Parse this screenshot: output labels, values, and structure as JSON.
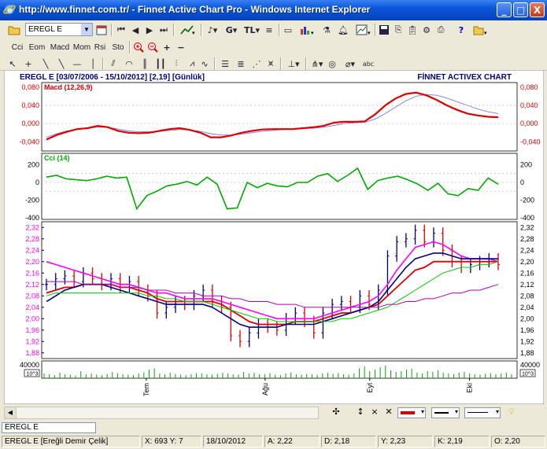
{
  "window": {
    "title": "http://www.finnet.com.tr/ - Finnet Active Chart Pro - Windows Internet Explorer",
    "minimize": "_",
    "maximize": "□",
    "close": "X"
  },
  "toolbar1": {
    "symbol": "EREGL E",
    "g_label": "G",
    "tl_label": "TL"
  },
  "toolbar2": {
    "indicators": [
      "Cci",
      "Eom",
      "Macd",
      "Mom",
      "Rsi",
      "Sto"
    ]
  },
  "chart_header": {
    "info": "EREGL E  [03/07/2006 - 15/10/2012]  [2,19]  [Günlük]",
    "brand": "FİNNET ACTIVEX CHART"
  },
  "chart_data": [
    {
      "type": "line",
      "title": "Macd (12,26,9)",
      "ylim": [
        -0.06,
        0.09
      ],
      "yticks": [
        "0,080",
        "0,040",
        "0,000",
        "-0,040"
      ],
      "yvalues": [
        0.08,
        0.04,
        0.0,
        -0.04
      ],
      "series": [
        {
          "color": "#dd0000",
          "values": [
            -0.035,
            -0.025,
            -0.018,
            -0.012,
            -0.01,
            -0.005,
            -0.008,
            -0.016,
            -0.02,
            -0.021,
            -0.02,
            -0.016,
            -0.012,
            -0.01,
            -0.014,
            -0.02,
            -0.03,
            -0.03,
            -0.026,
            -0.02,
            -0.016,
            -0.013,
            -0.012,
            -0.012,
            -0.012,
            -0.01,
            -0.008,
            -0.005,
            0.002,
            0.004,
            0.004,
            0.005,
            0.02,
            0.04,
            0.055,
            0.065,
            0.068,
            0.062,
            0.052,
            0.04,
            0.03,
            0.022,
            0.018,
            0.015,
            0.014
          ]
        },
        {
          "color": "#7a7af0",
          "values": [
            -0.03,
            -0.022,
            -0.016,
            -0.012,
            -0.01,
            -0.008,
            -0.008,
            -0.012,
            -0.016,
            -0.018,
            -0.018,
            -0.017,
            -0.015,
            -0.013,
            -0.014,
            -0.017,
            -0.022,
            -0.025,
            -0.025,
            -0.023,
            -0.02,
            -0.017,
            -0.015,
            -0.013,
            -0.012,
            -0.011,
            -0.01,
            -0.008,
            -0.004,
            0.0,
            0.002,
            0.003,
            0.01,
            0.022,
            0.036,
            0.05,
            0.06,
            0.064,
            0.062,
            0.056,
            0.048,
            0.04,
            0.032,
            0.026,
            0.022
          ]
        }
      ]
    },
    {
      "type": "line",
      "title": "Cci (14)",
      "ylim": [
        -420,
        330
      ],
      "yticks": [
        "200",
        "0",
        "-200",
        "-400"
      ],
      "yvalues": [
        200,
        0,
        -200,
        -400
      ],
      "series": [
        {
          "color": "#00aa00",
          "values": [
            60,
            80,
            40,
            30,
            20,
            40,
            70,
            50,
            60,
            -300,
            -150,
            -100,
            -40,
            -20,
            10,
            -30,
            60,
            -20,
            -300,
            -290,
            0,
            -60,
            -10,
            -40,
            -50,
            0,
            0,
            70,
            100,
            10,
            80,
            160,
            -80,
            20,
            50,
            70,
            30,
            -20,
            -90,
            -10,
            -130,
            -150,
            -70,
            -90,
            50,
            -20
          ]
        }
      ]
    },
    {
      "type": "candlestick",
      "title": "",
      "ylim": [
        1.86,
        2.34
      ],
      "yticks_left": [
        "2,32",
        "2,28",
        "2,24",
        "2,20",
        "2,16",
        "2,12",
        "2,08",
        "2,04",
        "2,00",
        "1,96",
        "1,92",
        "1,88"
      ],
      "yticks_right": [
        "2,32",
        "2,28",
        "2,24",
        "2,20",
        "2,16",
        "2,12",
        "2,08",
        "2,04",
        "2,00",
        "1,96",
        "1,92",
        "1,88"
      ],
      "yvalues": [
        2.32,
        2.28,
        2.24,
        2.2,
        2.16,
        2.12,
        2.08,
        2.04,
        2.0,
        1.96,
        1.92,
        1.88
      ],
      "close": [
        2.12,
        2.14,
        2.15,
        2.13,
        2.16,
        2.14,
        2.12,
        2.14,
        2.11,
        2.13,
        2.1,
        2.08,
        2.02,
        2.04,
        2.06,
        2.05,
        2.08,
        2.1,
        2.06,
        2.04,
        1.94,
        1.92,
        1.95,
        1.98,
        1.97,
        1.96,
        2.0,
        2.02,
        1.99,
        1.95,
        2.02,
        2.05,
        2.06,
        2.04,
        2.08,
        2.05,
        2.1,
        2.22,
        2.27,
        2.28,
        2.31,
        2.27,
        2.3,
        2.24,
        2.2,
        2.18,
        2.19,
        2.2,
        2.21,
        2.19
      ],
      "series": [
        {
          "color": "#dd0000",
          "values": [
            2.09,
            2.1,
            2.11,
            2.11,
            2.12,
            2.12,
            2.12,
            2.12,
            2.11,
            2.11,
            2.1,
            2.09,
            2.07,
            2.06,
            2.06,
            2.06,
            2.06,
            2.06,
            2.06,
            2.05,
            2.03,
            2.01,
            1.99,
            1.98,
            1.98,
            1.98,
            1.98,
            1.99,
            1.99,
            1.99,
            2.0,
            2.01,
            2.02,
            2.02,
            2.03,
            2.04,
            2.05,
            2.08,
            2.11,
            2.14,
            2.17,
            2.18,
            2.2,
            2.2,
            2.2,
            2.2,
            2.2,
            2.2,
            2.2,
            2.2
          ]
        },
        {
          "color": "#ff00ff",
          "values": [
            2.2,
            2.19,
            2.18,
            2.17,
            2.16,
            2.15,
            2.14,
            2.13,
            2.12,
            2.12,
            2.11,
            2.1,
            2.09,
            2.09,
            2.08,
            2.07,
            2.07,
            2.07,
            2.07,
            2.06,
            2.05,
            2.04,
            2.03,
            2.02,
            2.01,
            2.0,
            2.0,
            2.0,
            2.0,
            2.0,
            2.01,
            2.02,
            2.03,
            2.04,
            2.05,
            2.06,
            2.08,
            2.12,
            2.17,
            2.21,
            2.25,
            2.26,
            2.27,
            2.26,
            2.24,
            2.22,
            2.21,
            2.21,
            2.21,
            2.2
          ]
        },
        {
          "color": "#000080",
          "values": [
            2.06,
            2.08,
            2.1,
            2.11,
            2.12,
            2.12,
            2.12,
            2.11,
            2.1,
            2.09,
            2.08,
            2.07,
            2.06,
            2.05,
            2.05,
            2.05,
            2.05,
            2.05,
            2.04,
            2.02,
            2.0,
            1.98,
            1.97,
            1.97,
            1.97,
            1.97,
            1.98,
            1.98,
            1.98,
            1.98,
            1.99,
            2.0,
            2.01,
            2.02,
            2.03,
            2.04,
            2.06,
            2.1,
            2.14,
            2.18,
            2.21,
            2.22,
            2.23,
            2.23,
            2.22,
            2.21,
            2.21,
            2.21,
            2.21,
            2.21
          ]
        },
        {
          "color": "#00cc00",
          "values": [
            2.08,
            2.09,
            2.09,
            2.09,
            2.09,
            2.09,
            2.09,
            2.09,
            2.09,
            2.09,
            2.09,
            2.08,
            2.08,
            2.07,
            2.07,
            2.06,
            2.06,
            2.06,
            2.05,
            2.04,
            2.03,
            2.02,
            2.01,
            2.0,
            2.0,
            1.99,
            1.99,
            1.99,
            1.99,
            1.99,
            1.99,
            1.99,
            2.0,
            2.0,
            2.01,
            2.02,
            2.03,
            2.04,
            2.06,
            2.08,
            2.1,
            2.12,
            2.14,
            2.16,
            2.17,
            2.18,
            2.18,
            2.19,
            2.19,
            2.2
          ]
        },
        {
          "color": "#b800b8",
          "values": [
            2.13,
            2.13,
            2.13,
            2.13,
            2.12,
            2.12,
            2.12,
            2.12,
            2.11,
            2.11,
            2.11,
            2.1,
            2.1,
            2.1,
            2.09,
            2.09,
            2.09,
            2.08,
            2.08,
            2.08,
            2.07,
            2.07,
            2.06,
            2.06,
            2.06,
            2.05,
            2.05,
            2.05,
            2.04,
            2.04,
            2.04,
            2.04,
            2.04,
            2.04,
            2.04,
            2.04,
            2.04,
            2.05,
            2.05,
            2.06,
            2.06,
            2.07,
            2.07,
            2.08,
            2.09,
            2.09,
            2.1,
            2.1,
            2.11,
            2.12
          ]
        }
      ]
    },
    {
      "type": "bar",
      "title": "",
      "yticks": [
        "40000",
        "10^3"
      ],
      "yticks_right": [
        "40000",
        "10^3"
      ],
      "values": [
        12,
        10,
        8,
        14,
        10,
        9,
        7,
        18,
        10,
        12,
        9,
        8,
        11,
        16,
        13,
        10,
        9,
        8,
        12,
        15,
        22,
        25,
        12,
        10,
        14,
        11,
        9,
        8,
        10,
        13,
        12,
        10,
        9,
        11,
        14,
        12,
        10,
        9,
        16,
        12,
        14,
        10,
        11,
        13,
        9,
        8,
        12,
        15,
        10,
        9,
        11,
        10,
        9,
        12,
        14,
        11,
        13,
        10,
        9,
        12,
        25,
        30,
        18,
        22,
        28,
        32,
        20,
        16,
        18,
        22,
        24,
        14,
        12,
        18,
        16,
        20,
        14,
        12,
        10,
        14,
        16,
        12,
        10,
        9,
        11,
        13,
        10,
        12,
        14,
        10
      ],
      "xticks": [
        "Tem",
        "Ağu",
        "Eyl",
        "Eki"
      ],
      "xtick_pos": [
        0.22,
        0.47,
        0.69,
        0.9
      ]
    }
  ],
  "bottom_toolbar": {
    "buttons": [
      "↕",
      "×",
      "✕",
      "✣"
    ]
  },
  "symbol_field": "EREGL E",
  "status": {
    "name": "EREGL E [Ereğli Demir Çelik]",
    "xy": "X: 693 Y: 7",
    "date": "18/10/2012",
    "a": "A: 2,22",
    "d": "D: 2,18",
    "y": "Y: 2,23",
    "k": "K: 2,19",
    "o": "O: 2,20"
  }
}
